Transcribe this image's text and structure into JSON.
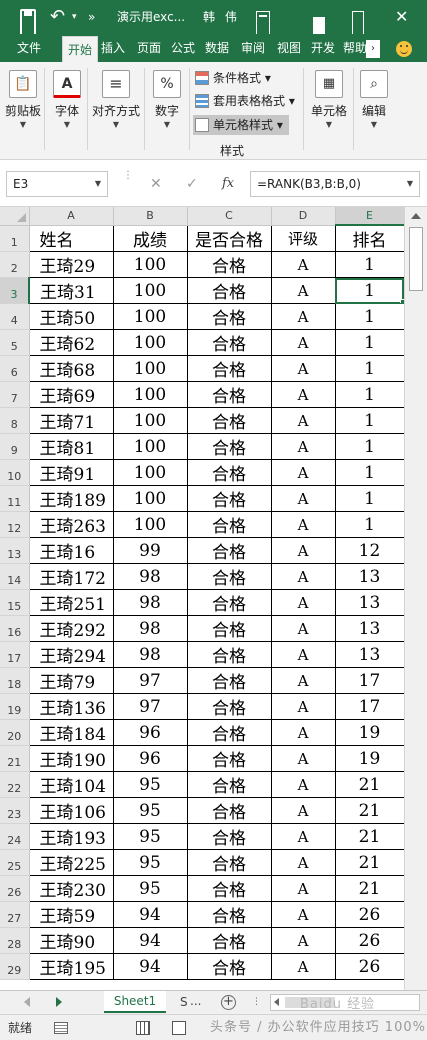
{
  "titlebar": {
    "doc_title": "演示用exc...",
    "user_name": "韩 伟",
    "more": "»",
    "close": "✕",
    "undo": "↶",
    "dropdown": "▾"
  },
  "ribbon": {
    "tabs": [
      "文件",
      "开始",
      "插入",
      "页面",
      "公式",
      "数据",
      "审阅",
      "视图",
      "开发",
      "帮助"
    ],
    "active_tab": "开始",
    "more": "›",
    "groups": {
      "clipboard": "剪贴板",
      "font": "字体",
      "alignment": "对齐方式",
      "number": "数字",
      "cells": "单元格",
      "editing": "编辑"
    },
    "style_items": {
      "conditional": "条件格式 ▾",
      "table_format": "套用表格格式 ▾",
      "cell_styles": "单元格样式 ▾"
    },
    "styles_label": "样式"
  },
  "formula_bar": {
    "name_box": "E3",
    "cancel": "✕",
    "confirm": "✓",
    "fx": "fx",
    "formula": "=RANK(B3,B:B,0)"
  },
  "grid": {
    "columns": [
      "A",
      "B",
      "C",
      "D",
      "E"
    ],
    "selected_column": "E",
    "selected_row": 3,
    "rows": [
      {
        "n": 1,
        "cells": [
          "姓名",
          "成绩",
          "是否合格",
          "评级",
          "排名"
        ]
      },
      {
        "n": 2,
        "cells": [
          "王琦29",
          "100",
          "合格",
          "A",
          "1"
        ]
      },
      {
        "n": 3,
        "cells": [
          "王琦31",
          "100",
          "合格",
          "A",
          "1"
        ]
      },
      {
        "n": 4,
        "cells": [
          "王琦50",
          "100",
          "合格",
          "A",
          "1"
        ]
      },
      {
        "n": 5,
        "cells": [
          "王琦62",
          "100",
          "合格",
          "A",
          "1"
        ]
      },
      {
        "n": 6,
        "cells": [
          "王琦68",
          "100",
          "合格",
          "A",
          "1"
        ]
      },
      {
        "n": 7,
        "cells": [
          "王琦69",
          "100",
          "合格",
          "A",
          "1"
        ]
      },
      {
        "n": 8,
        "cells": [
          "王琦71",
          "100",
          "合格",
          "A",
          "1"
        ]
      },
      {
        "n": 9,
        "cells": [
          "王琦81",
          "100",
          "合格",
          "A",
          "1"
        ]
      },
      {
        "n": 10,
        "cells": [
          "王琦91",
          "100",
          "合格",
          "A",
          "1"
        ]
      },
      {
        "n": 11,
        "cells": [
          "王琦189",
          "100",
          "合格",
          "A",
          "1"
        ]
      },
      {
        "n": 12,
        "cells": [
          "王琦263",
          "100",
          "合格",
          "A",
          "1"
        ]
      },
      {
        "n": 13,
        "cells": [
          "王琦16",
          "99",
          "合格",
          "A",
          "12"
        ]
      },
      {
        "n": 14,
        "cells": [
          "王琦172",
          "98",
          "合格",
          "A",
          "13"
        ]
      },
      {
        "n": 15,
        "cells": [
          "王琦251",
          "98",
          "合格",
          "A",
          "13"
        ]
      },
      {
        "n": 16,
        "cells": [
          "王琦292",
          "98",
          "合格",
          "A",
          "13"
        ]
      },
      {
        "n": 17,
        "cells": [
          "王琦294",
          "98",
          "合格",
          "A",
          "13"
        ]
      },
      {
        "n": 18,
        "cells": [
          "王琦79",
          "97",
          "合格",
          "A",
          "17"
        ]
      },
      {
        "n": 19,
        "cells": [
          "王琦136",
          "97",
          "合格",
          "A",
          "17"
        ]
      },
      {
        "n": 20,
        "cells": [
          "王琦184",
          "96",
          "合格",
          "A",
          "19"
        ]
      },
      {
        "n": 21,
        "cells": [
          "王琦190",
          "96",
          "合格",
          "A",
          "19"
        ]
      },
      {
        "n": 22,
        "cells": [
          "王琦104",
          "95",
          "合格",
          "A",
          "21"
        ]
      },
      {
        "n": 23,
        "cells": [
          "王琦106",
          "95",
          "合格",
          "A",
          "21"
        ]
      },
      {
        "n": 24,
        "cells": [
          "王琦193",
          "95",
          "合格",
          "A",
          "21"
        ]
      },
      {
        "n": 25,
        "cells": [
          "王琦225",
          "95",
          "合格",
          "A",
          "21"
        ]
      },
      {
        "n": 26,
        "cells": [
          "王琦230",
          "95",
          "合格",
          "A",
          "21"
        ]
      },
      {
        "n": 27,
        "cells": [
          "王琦59",
          "94",
          "合格",
          "A",
          "26"
        ]
      },
      {
        "n": 28,
        "cells": [
          "王琦90",
          "94",
          "合格",
          "A",
          "26"
        ]
      },
      {
        "n": 29,
        "cells": [
          "王琦195",
          "94",
          "合格",
          "A",
          "26"
        ]
      }
    ]
  },
  "sheet_tabs": {
    "active": "Sheet1",
    "partial": "S",
    "more": "...",
    "add": "+",
    "separator": "⋮",
    "watermark": "Baidu 经验"
  },
  "statusbar": {
    "status": "就绪",
    "watermark": "头条号 / 办公软件应用技巧",
    "zoom": "100%"
  },
  "colors": {
    "accent": "#217346"
  }
}
